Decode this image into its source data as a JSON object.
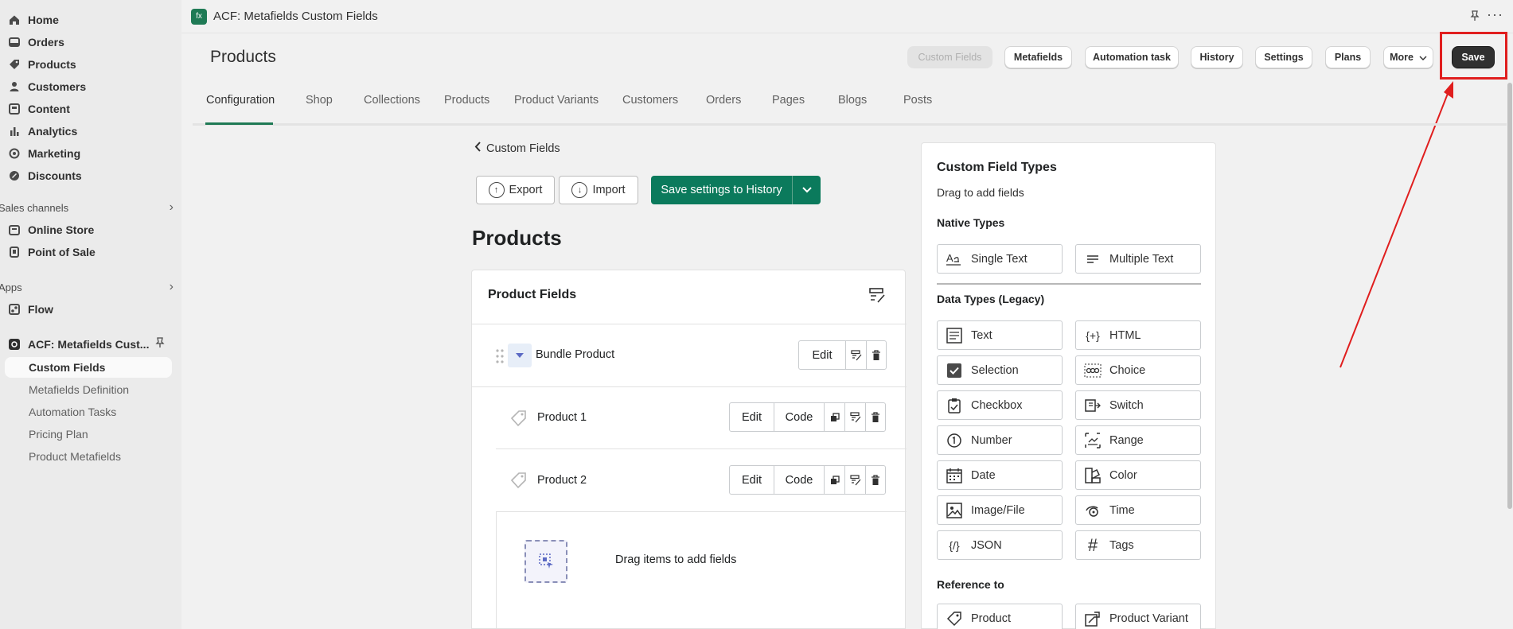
{
  "sidebar": {
    "items": [
      {
        "label": "Home",
        "icon": "home-icon"
      },
      {
        "label": "Orders",
        "icon": "orders-icon"
      },
      {
        "label": "Products",
        "icon": "tag-icon"
      },
      {
        "label": "Customers",
        "icon": "person-icon"
      },
      {
        "label": "Content",
        "icon": "content-icon"
      },
      {
        "label": "Analytics",
        "icon": "bar-chart-icon"
      },
      {
        "label": "Marketing",
        "icon": "target-icon"
      },
      {
        "label": "Discounts",
        "icon": "discount-icon"
      }
    ],
    "sales_channels": "Sales channels",
    "channels": [
      {
        "label": "Online Store",
        "icon": "store-icon"
      },
      {
        "label": "Point of Sale",
        "icon": "pos-icon"
      }
    ],
    "apps": "Apps",
    "apps_items": [
      {
        "label": "Flow",
        "icon": "flow-icon"
      }
    ],
    "app_name": "ACF: Metafields Cust...",
    "subitems": [
      "Custom Fields",
      "Metafields Definition",
      "Automation Tasks",
      "Pricing Plan",
      "Product Metafields"
    ]
  },
  "topbar": {
    "title": "ACF: Metafields Custom Fields"
  },
  "header": {
    "title": "Products",
    "buttons": {
      "custom_fields": "Custom Fields",
      "metafields": "Metafields",
      "automation": "Automation task",
      "history": "History",
      "settings": "Settings",
      "plans": "Plans",
      "more": "More",
      "save": "Save"
    }
  },
  "tabs": [
    "Configuration",
    "Shop",
    "Collections",
    "Products",
    "Product Variants",
    "Customers",
    "Orders",
    "Pages",
    "Blogs",
    "Posts"
  ],
  "main": {
    "back": "Custom Fields",
    "export": "Export",
    "import": "Import",
    "save_history": "Save settings to History",
    "section_title": "Products",
    "card_title": "Product Fields",
    "rows": {
      "bundle": "Bundle Product",
      "p1": "Product 1",
      "p2": "Product 2",
      "edit": "Edit",
      "code": "Code"
    },
    "drop_text": "Drag items to add fields"
  },
  "panel": {
    "title": "Custom Field Types",
    "subtitle": "Drag to add fields",
    "native": "Native Types",
    "native_types": [
      "Single Text",
      "Multiple Text"
    ],
    "legacy": "Data Types (Legacy)",
    "legacy_types": [
      "Text",
      "HTML",
      "Selection",
      "Choice",
      "Checkbox",
      "Switch",
      "Number",
      "Range",
      "Date",
      "Color",
      "Image/File",
      "Time",
      "JSON",
      "Tags"
    ],
    "reference": "Reference to",
    "reference_types": [
      "Product",
      "Product Variant"
    ]
  }
}
